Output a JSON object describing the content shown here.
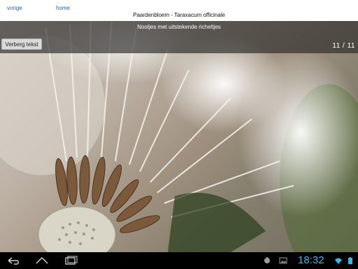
{
  "nav": {
    "prev_label": "vorige",
    "home_label": "home"
  },
  "header": {
    "title": "Paardenbloem - Taraxacum officinale"
  },
  "image": {
    "caption": "Nootjes met uitstekende richeltjes",
    "hide_text_label": "Verberg tekst",
    "counter": "11 / 11"
  },
  "system_bar": {
    "time": "18:32",
    "icons": [
      "back-icon",
      "home-icon",
      "recent-apps-icon",
      "usb-debug-icon",
      "image-notification-icon",
      "download-icon",
      "wifi-icon",
      "battery-icon"
    ],
    "clock_color": "#39b6e6"
  }
}
